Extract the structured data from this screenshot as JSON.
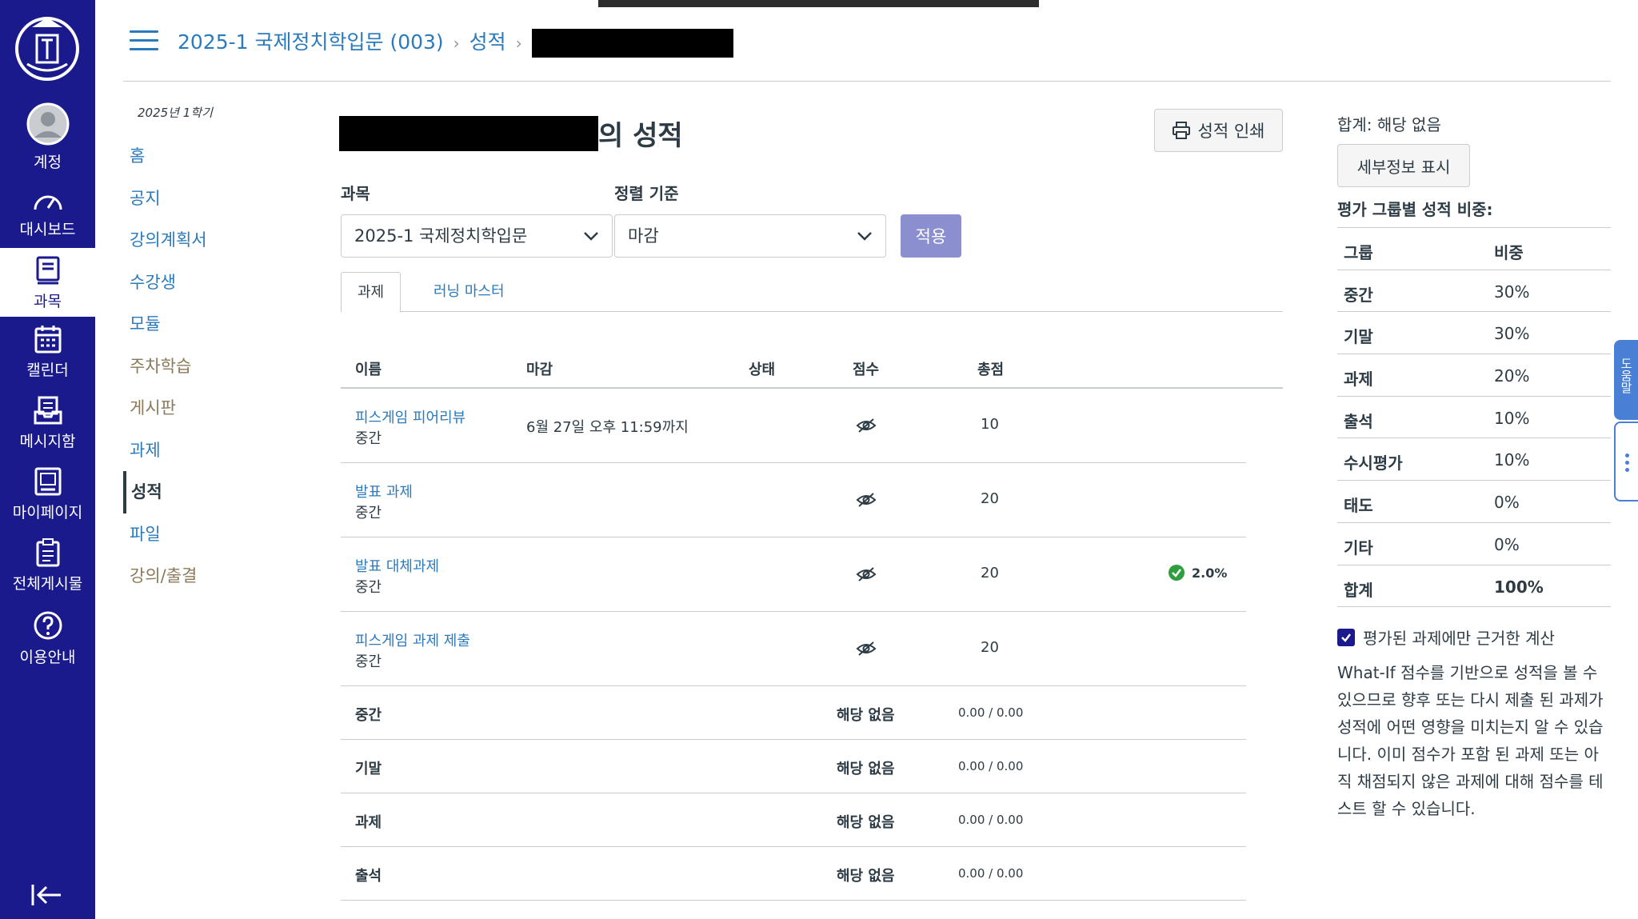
{
  "global_nav": {
    "items": [
      {
        "label": "계정",
        "icon": "user-icon"
      },
      {
        "label": "대시보드",
        "icon": "dashboard-icon"
      },
      {
        "label": "과목",
        "icon": "course-icon",
        "active": true
      },
      {
        "label": "캘린더",
        "icon": "calendar-icon"
      },
      {
        "label": "메시지함",
        "icon": "inbox-icon"
      },
      {
        "label": "마이페이지",
        "icon": "mypage-icon"
      },
      {
        "label": "전체게시물",
        "icon": "board-icon"
      },
      {
        "label": "이용안내",
        "icon": "help-icon"
      }
    ]
  },
  "breadcrumb": {
    "course": "2025-1 국제정치학입문 (003)",
    "section": "성적"
  },
  "course_nav": {
    "term": "2025년 1학기",
    "items": [
      {
        "label": "홈"
      },
      {
        "label": "공지"
      },
      {
        "label": "강의계획서"
      },
      {
        "label": "수강생"
      },
      {
        "label": "모듈"
      },
      {
        "label": "주차학습"
      },
      {
        "label": "게시판"
      },
      {
        "label": "과제"
      },
      {
        "label": "성적"
      },
      {
        "label": "파일"
      },
      {
        "label": "강의/출결"
      }
    ]
  },
  "main": {
    "title_suffix": "의 성적",
    "print_label": "성적 인쇄",
    "course_label": "과목",
    "sort_label": "정렬 기준",
    "course_value": "2025-1 국제정치학입문",
    "sort_value": "마감",
    "apply_label": "적용",
    "tabs": [
      "과제",
      "러닝 마스터"
    ],
    "columns": [
      "이름",
      "마감",
      "상태",
      "점수",
      "총점"
    ],
    "assignments": [
      {
        "name": "피스게임 피어리뷰",
        "group": "중간",
        "due": "6월 27일 오후 11:59까지",
        "total": "10",
        "percent": ""
      },
      {
        "name": "발표 과제",
        "group": "중간",
        "due": "",
        "total": "20",
        "percent": ""
      },
      {
        "name": "발표 대체과제",
        "group": "중간",
        "due": "",
        "total": "20",
        "percent": "2.0%"
      },
      {
        "name": "피스게임 과제 제출",
        "group": "중간",
        "due": "",
        "total": "20",
        "percent": ""
      }
    ],
    "group_rows": [
      {
        "name": "중간",
        "score": "해당 없음",
        "points": "0.00 / 0.00"
      },
      {
        "name": "기말",
        "score": "해당 없음",
        "points": "0.00 / 0.00"
      },
      {
        "name": "과제",
        "score": "해당 없음",
        "points": "0.00 / 0.00"
      },
      {
        "name": "출석",
        "score": "해당 없음",
        "points": "0.00 / 0.00"
      }
    ]
  },
  "right": {
    "total": "합계: 해당 없음",
    "details_label": "세부정보 표시",
    "weights_title": "평가 그룹별 성적 비중:",
    "weights_header": {
      "group": "그룹",
      "weight": "비중"
    },
    "weights": [
      {
        "group": "중간",
        "weight": "30%"
      },
      {
        "group": "기말",
        "weight": "30%"
      },
      {
        "group": "과제",
        "weight": "20%"
      },
      {
        "group": "출석",
        "weight": "10%"
      },
      {
        "group": "수시평가",
        "weight": "10%"
      },
      {
        "group": "태도",
        "weight": "0%"
      },
      {
        "group": "기타",
        "weight": "0%"
      },
      {
        "group": "합계",
        "weight": "100%"
      }
    ],
    "calc_label": "평가된 과제에만 근거한 계산",
    "whatif_text": "What-If 점수를 기반으로 성적을 볼 수 있으므로 향후 또는 다시 제출 된 과제가 성적에 어떤 영향을 미치는지 알 수 있습니다. 이미 점수가 포함 된 과제 또는 아직 채점되지 않은 과제에 대해 점수를 테스트 할 수 있습니다."
  },
  "help_tab": "도움말",
  "colors": {
    "nav": "#1a1a8c",
    "link": "#2b7abc",
    "apply": "#8c8fcf",
    "check": "#2e9e3e"
  }
}
